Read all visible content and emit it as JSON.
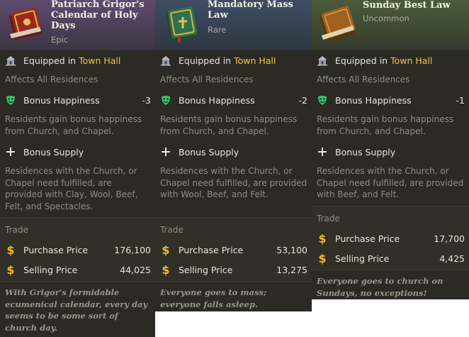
{
  "colors": {
    "accent": "#f0c84a",
    "happiness_icon": "#3cc06a",
    "coin": "#f0b82a"
  },
  "cards": [
    {
      "title": "Patriarch Grigor's Calendar of Holy Days",
      "rarity": "Epic",
      "equipped_prefix": "Equipped in ",
      "equipped_place": "Town Hall",
      "affects": "Affects All Residences",
      "happiness_label": "Bonus Happiness",
      "happiness_value": "-3",
      "happiness_desc": "Residents gain bonus happiness from Church, and Chapel.",
      "supply_label": "Bonus Supply",
      "supply_desc": "Residences with the Church, or Chapel need fulfilled, are provided with Clay, Wool, Beef, Felt, and Spectacles.",
      "trade_label": "Trade",
      "purchase_label": "Purchase Price",
      "purchase_value": "176,100",
      "selling_label": "Selling Price",
      "selling_value": "44,025",
      "flavor": "With Grigor's formidable ecumenical calendar, every day seems to be some sort of church day."
    },
    {
      "title": "Mandatory Mass Law",
      "rarity": "Rare",
      "equipped_prefix": "Equipped in ",
      "equipped_place": "Town Hall",
      "affects": "Affects All Residences",
      "happiness_label": "Bonus Happiness",
      "happiness_value": "-2",
      "happiness_desc": "Residents gain bonus happiness from Church, and Chapel.",
      "supply_label": "Bonus Supply",
      "supply_desc": "Residences with the Church, or Chapel need fulfilled, are provided with Wool, Beef, and Felt.",
      "trade_label": "Trade",
      "purchase_label": "Purchase Price",
      "purchase_value": "53,100",
      "selling_label": "Selling Price",
      "selling_value": "13,275",
      "flavor": "Everyone goes to mass; everyone falls asleep."
    },
    {
      "title": "Sunday Best Law",
      "rarity": "Uncommon",
      "equipped_prefix": "Equipped in ",
      "equipped_place": "Town Hall",
      "affects": "Affects All Residences",
      "happiness_label": "Bonus Happiness",
      "happiness_value": "-1",
      "happiness_desc": "Residents gain bonus happiness from Church, and Chapel.",
      "supply_label": "Bonus Supply",
      "supply_desc": "Residences with the Church, or Chapel need fulfilled, are provided with Beef, and Felt.",
      "trade_label": "Trade",
      "purchase_label": "Purchase Price",
      "purchase_value": "17,700",
      "selling_label": "Selling Price",
      "selling_value": "4,425",
      "flavor": "Everyone goes to church on Sundays, no exceptions!"
    }
  ]
}
